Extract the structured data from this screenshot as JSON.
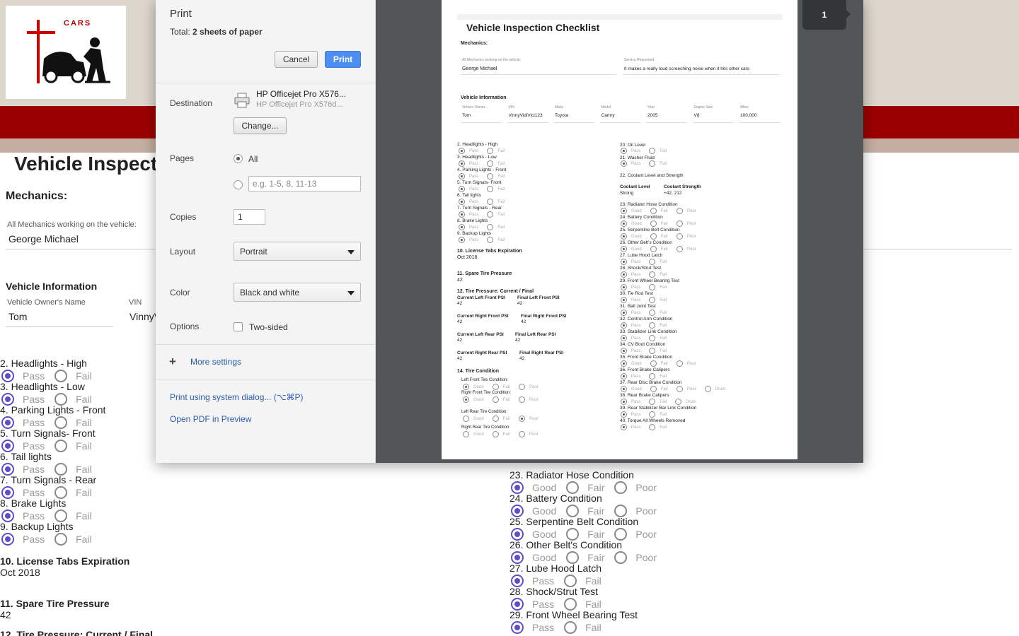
{
  "site": {
    "logo_text": "CARS",
    "title": "Vehicle Inspect",
    "mechanics_heading": "Mechanics:",
    "mechanics_label": "All Mechanics working on the vehicle:",
    "mechanics_value": "George Michael",
    "vehicle_heading": "Vehicle Information",
    "owner_label": "Vehicle Owner's Name",
    "owner_value": "Tom",
    "vin_label": "VIN",
    "vin_value": "VinnyV",
    "left_questions": [
      {
        "q": "2. Headlights - High",
        "opts": [
          "Pass",
          "Fail"
        ]
      },
      {
        "q": "3. Headlights - Low",
        "opts": [
          "Pass",
          "Fail"
        ]
      },
      {
        "q": "4. Parking Lights - Front",
        "opts": [
          "Pass",
          "Fail"
        ]
      },
      {
        "q": "5. Turn Signals- Front",
        "opts": [
          "Pass",
          "Fail"
        ]
      },
      {
        "q": "6. Tail lights",
        "opts": [
          "Pass",
          "Fail"
        ]
      },
      {
        "q": "7. Turn Signals - Rear",
        "opts": [
          "Pass",
          "Fail"
        ]
      },
      {
        "q": "8. Brake Lights",
        "opts": [
          "Pass",
          "Fail"
        ]
      },
      {
        "q": "9. Backup Lights",
        "opts": [
          "Pass",
          "Fail"
        ]
      }
    ],
    "license_heading": "10. License Tabs Expiration",
    "license_value": "Oct 2018",
    "spare_heading": "11. Spare Tire Pressure",
    "spare_value": "42",
    "tire_heading": "12. Tire Pressure: Current / Final",
    "right_questions": [
      {
        "q": "23. Radiator Hose Condition",
        "opts": [
          "Good",
          "Fair",
          "Poor"
        ]
      },
      {
        "q": "24. Battery Condition",
        "opts": [
          "Good",
          "Fair",
          "Poor"
        ]
      },
      {
        "q": "25. Serpentine Belt Condition",
        "opts": [
          "Good",
          "Fair",
          "Poor"
        ]
      },
      {
        "q": "26. Other Belt's Condition",
        "opts": [
          "Good",
          "Fair",
          "Poor"
        ]
      },
      {
        "q": "27. Lube Hood Latch",
        "opts": [
          "Pass",
          "Fail"
        ]
      },
      {
        "q": "28. Shock/Strut Test",
        "opts": [
          "Pass",
          "Fail"
        ]
      },
      {
        "q": "29. Front Wheel Bearing Test",
        "opts": [
          "Pass",
          "Fail"
        ]
      }
    ]
  },
  "dialog": {
    "title": "Print",
    "total_prefix": "Total: ",
    "total_value": "2 sheets of paper",
    "cancel_label": "Cancel",
    "print_label": "Print",
    "destination_label": "Destination",
    "destination_name": "HP Officejet Pro X576...",
    "destination_sub": "HP Officejet Pro X576d...",
    "change_label": "Change...",
    "pages_label": "Pages",
    "pages_all": "All",
    "pages_placeholder": "e.g. 1-5, 8, 11-13",
    "copies_label": "Copies",
    "copies_value": "1",
    "layout_label": "Layout",
    "layout_value": "Portrait",
    "color_label": "Color",
    "color_value": "Black and white",
    "options_label": "Options",
    "two_sided": "Two-sided",
    "more_settings": "More settings",
    "system_dialog": "Print using system dialog... (⌥⌘P)",
    "open_pdf": "Open PDF in Preview",
    "page_number": "1"
  },
  "preview": {
    "title": "Vehicle Inspection Checklist",
    "mechanics": "Mechanics:",
    "mech_label": "All Mechanics working on the vehicle:",
    "mech_value": "George Michael",
    "service_label": "Service Requested",
    "service_value": "It makes a really loud screeching noise when it hits other cars",
    "vehicle_info": "Vehicle Information",
    "fields": [
      {
        "label": "Vehicle Owner...",
        "value": "Tom"
      },
      {
        "label": "VIN",
        "value": "VinnyVidiVici123"
      },
      {
        "label": "Make",
        "value": "Toyota"
      },
      {
        "label": "Model",
        "value": "Camry"
      },
      {
        "label": "Year",
        "value": "2005"
      },
      {
        "label": "Engine Size",
        "value": "V8"
      },
      {
        "label": "Miles",
        "value": "100,000"
      }
    ],
    "left_items": [
      "2. Headlights - High",
      "3. Headlights - Low",
      "4. Parking Lights - Front",
      "5. Turn Signals- Front",
      "6. Tail lights",
      "7. Turn Signals - Rear",
      "8. Brake Lights",
      "9. Backup Lights"
    ],
    "pass": "Pass",
    "fail": "Fail",
    "good": "Good",
    "fair": "Fair",
    "poor": "Poor",
    "drum": "Drum",
    "license_h": "10. License Tabs Expiration",
    "license_v": "Oct 2018",
    "spare_h": "11. Spare Tire Pressure",
    "spare_v": "42",
    "tire_h": "12. Tire Pressure: Current / Final",
    "psi": [
      {
        "a": "Current Left Front PSI",
        "b": "Final Left Front PSI",
        "av": "42",
        "bv": "42"
      },
      {
        "a": "Current Right Front PSI",
        "b": "Final Right Front PSI",
        "av": "42",
        "bv": "42"
      },
      {
        "a": "Current Left Rear PSI",
        "b": "Final Left Rear PSI",
        "av": "42",
        "bv": "42"
      },
      {
        "a": "Current Right Rear PSI",
        "b": "Final Right Rear PSI",
        "av": "42",
        "bv": "42"
      }
    ],
    "tire_cond_h": "14. Tire Condition",
    "tire_conds": [
      "Left Front Tire Condition:",
      "Right Front Tire Condition:",
      "Left Rear Tire Condition:",
      "Right Rear Tire Condition"
    ],
    "oil": "20. Oil Level",
    "washer": "21. Washer Fluid",
    "coolant_h": "22. Coolant Level and Strength",
    "coolant_level_l": "Coolant Level",
    "coolant_level_v": "Strong",
    "coolant_str_l": "Coolant Strength",
    "coolant_str_v": "+42, 212",
    "right_items": [
      {
        "q": "23. Radiator Hose Condition",
        "t": "gfp"
      },
      {
        "q": "24. Battery Condition",
        "t": "gfp"
      },
      {
        "q": "25. Serpentine Belt Condition",
        "t": "gfp"
      },
      {
        "q": "26. Other Belt's Condition",
        "t": "gfp"
      },
      {
        "q": "27. Lube Hood Latch",
        "t": "pf"
      },
      {
        "q": "28. Shock/Strut Test",
        "t": "pf"
      },
      {
        "q": "29. Front Wheel Bearing Test",
        "t": "pf"
      },
      {
        "q": "30. Tie Rod Test",
        "t": "pf"
      },
      {
        "q": "31. Ball Joint Test",
        "t": "pf"
      },
      {
        "q": "32. Control Arm Condition",
        "t": "pf"
      },
      {
        "q": "33. Stabilizer Link Condition",
        "t": "pf"
      },
      {
        "q": "34. CV Boot Condition",
        "t": "pf"
      },
      {
        "q": "35. Front Brake Condition",
        "t": "gfp"
      },
      {
        "q": "36. Front Brake Calipers",
        "t": "pf"
      },
      {
        "q": "37. Rear Disc Brake Condition",
        "t": "gfpd"
      },
      {
        "q": "38. Rear Brake Calipers",
        "t": "pfd"
      },
      {
        "q": "39. Rear Stabilizer Bar Link Condition",
        "t": "pf"
      },
      {
        "q": "40. Torque All Wheels Removed",
        "t": "pf"
      }
    ]
  }
}
